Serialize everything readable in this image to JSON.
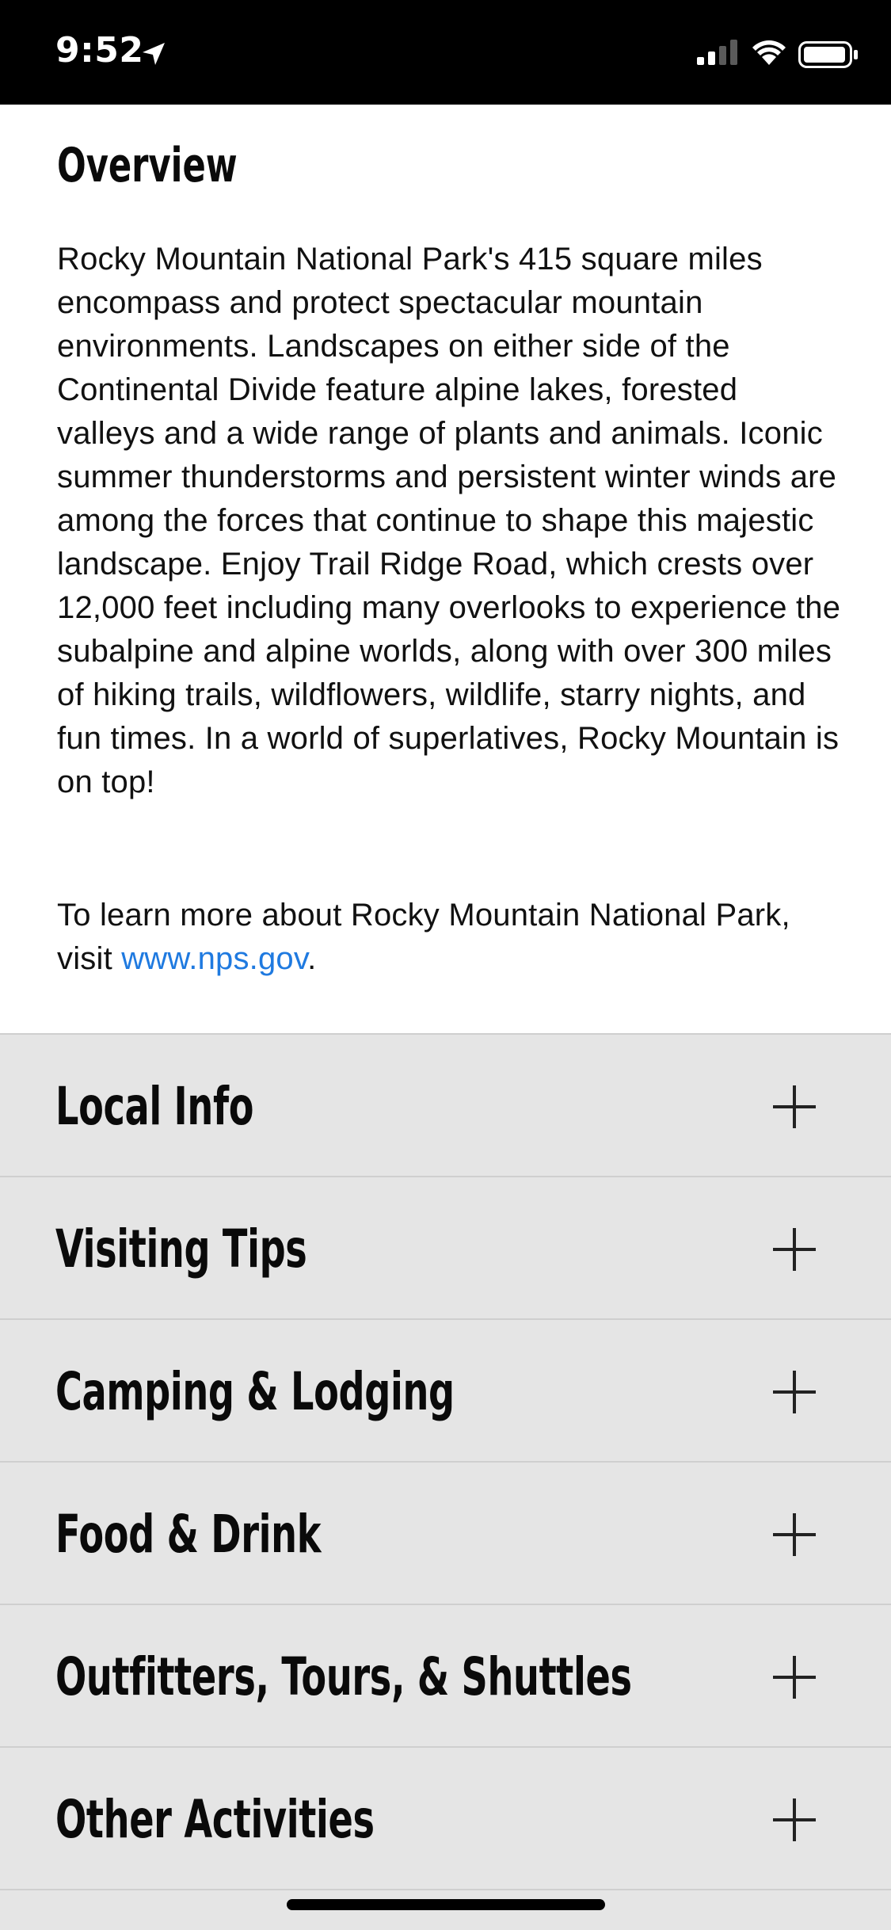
{
  "status_bar": {
    "time": "9:52",
    "location_icon": "location-arrow-icon",
    "signal_icon": "cellular-signal-icon",
    "wifi_icon": "wifi-icon",
    "battery_icon": "battery-icon"
  },
  "overview": {
    "title": "Overview",
    "body": "Rocky Mountain National Park's 415 square miles encompass and protect spectacular mountain environments. Landscapes on either side of the Continental Divide feature alpine lakes, forested valleys and a wide range of plants and animals. Iconic summer thunderstorms and persistent winter winds are among the forces that continue to shape this majestic landscape. Enjoy Trail Ridge Road, which crests over 12,000 feet including many overlooks to experience the subalpine and alpine worlds, along with over 300 miles of hiking trails, wildflowers, wildlife, starry nights, and fun times. In a world of superlatives, Rocky Mountain is on top!",
    "more_prefix": "To learn more about Rocky Mountain National Park, visit ",
    "link_text": "www.nps.gov",
    "more_suffix": "."
  },
  "sections": [
    {
      "label": "Local Info",
      "icon": "plus-icon"
    },
    {
      "label": "Visiting Tips",
      "icon": "plus-icon"
    },
    {
      "label": "Camping & Lodging",
      "icon": "plus-icon"
    },
    {
      "label": "Food & Drink",
      "icon": "plus-icon"
    },
    {
      "label": "Outfitters, Tours, & Shuttles",
      "icon": "plus-icon"
    },
    {
      "label": "Other Activities",
      "icon": "plus-icon"
    }
  ],
  "colors": {
    "link": "#1f7ae0",
    "status_bar_bg": "#000000",
    "accordion_bg": "#e5e5e5",
    "panel_bg": "#ffffff"
  }
}
